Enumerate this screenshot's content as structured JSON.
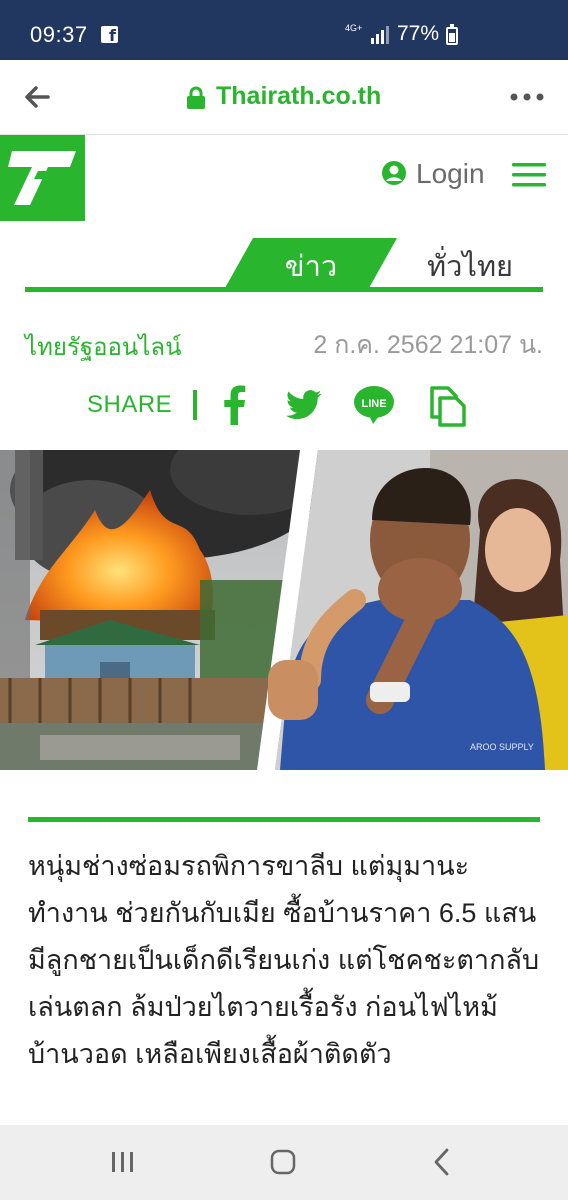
{
  "status_bar": {
    "time": "09:37",
    "network": "4G+",
    "battery": "77%",
    "battery_level": 0.77
  },
  "browser": {
    "url": "Thairath.co.th"
  },
  "site": {
    "login_label": "Login",
    "brand_color": "#2ab52f"
  },
  "tabs": {
    "active": "ข่าว",
    "second": "ทั่วไทย"
  },
  "byline": {
    "source": "ไทยรัฐออนไลน์",
    "date": "2 ก.ค. 2562 21:07 น."
  },
  "share": {
    "label": "SHARE",
    "line_label": "LINE"
  },
  "hero": {
    "shirt_text": "AROO SUPPLY"
  },
  "article": {
    "lede": "หนุ่มช่างซ่อมรถพิการขาลีบ แต่มุมานะทำงาน ช่วยกันกับเมีย ซื้อบ้านราคา 6.5 แสน มีลูกชายเป็นเด็กดีเรียนเก่ง แต่โชคชะตากลับเล่นตลก ล้มป่วยไตวายเรื้อรัง ก่อนไฟไหม้บ้านวอด เหลือเพียงเสื้อผ้าติดตัว"
  }
}
